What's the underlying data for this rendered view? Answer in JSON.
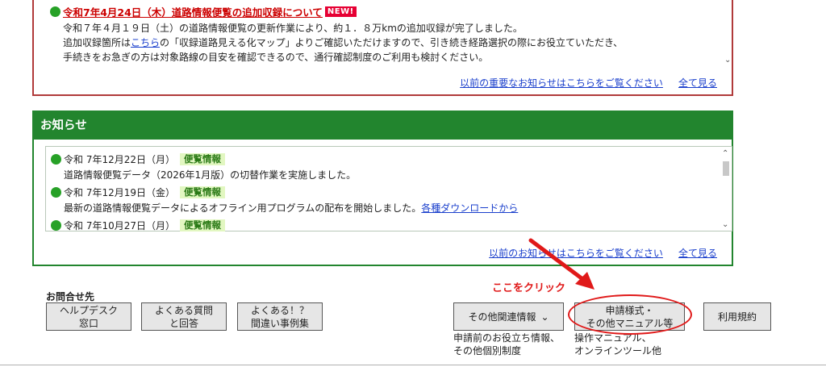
{
  "important": {
    "title": "令和7年4月24日（木）道路情報便覧の追加収録について",
    "badge": "NEW!",
    "line1": "令和７年４月１９日（土）の道路情報便覧の更新作業により、約１．８万kmの追加収録が完了しました。",
    "line2_pre": "追加収録箇所は",
    "line2_link": "こちら",
    "line2_post": "の「収録道路見える化マップ」よりご確認いただけますので、引き続き経路選択の際にお役立ていただき、",
    "line3": "手続きをお急ぎの方は対象路線の目安を確認できるので、通行確認制度のご利用も検討ください。",
    "past_link": "以前の重要なお知らせはこちらをご覧ください",
    "all_link": "全て見る"
  },
  "news": {
    "heading": "お知らせ",
    "items": [
      {
        "date": "令和 7年12月22日（月）",
        "category": "便覧情報",
        "body": "道路情報便覧データ（2026年1月版）の切替作業を実施しました。",
        "link": ""
      },
      {
        "date": "令和 7年12月19日（金）",
        "category": "便覧情報",
        "body": "最新の道路情報便覧データによるオフライン用プログラムの配布を開始しました。",
        "link": "各種ダウンロードから"
      },
      {
        "date": "令和 7年10月27日（月）",
        "category": "便覧情報",
        "body": "",
        "link": ""
      }
    ],
    "past_link": "以前のお知らせはこちらをご覧ください",
    "all_link": "全て見る"
  },
  "footer": {
    "contact_label": "お問合せ先",
    "helpdesk": [
      "ヘルプデスク",
      "窓口"
    ],
    "faq": [
      "よくある質問",
      "と回答"
    ],
    "mistakes": [
      "よくある！？",
      "間違い事例集"
    ],
    "related": "その他関連情報",
    "related_desc": [
      "申請前のお役立ち情報、",
      "その他個別制度"
    ],
    "forms": [
      "申請様式・",
      "その他マニュアル等"
    ],
    "forms_desc": [
      "操作マニュアル、",
      "オンラインツール他"
    ],
    "terms": "利用規約"
  },
  "annotation": {
    "hint": "ここをクリック",
    "color": "#e01919"
  }
}
